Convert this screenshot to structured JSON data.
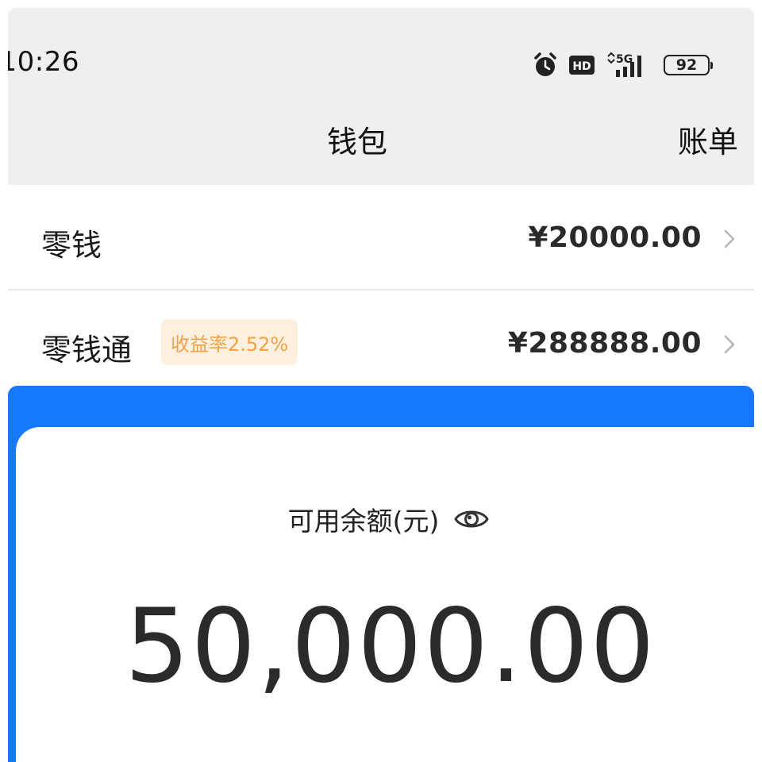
{
  "status_bar": {
    "time": "10:26",
    "battery": "92",
    "network": "5G",
    "hd": "HD",
    "icons": [
      "alarm-icon",
      "hd-icon",
      "signal-5g-icon",
      "battery-icon"
    ]
  },
  "nav": {
    "title": "钱包",
    "action": "账单"
  },
  "rows": [
    {
      "label": "零钱",
      "amount": "¥20000.00",
      "icon": "chevron-right-icon"
    },
    {
      "label": "零钱通",
      "badge": "收益率2.52%",
      "amount": "¥288888.00",
      "icon": "chevron-right-icon"
    }
  ],
  "balance": {
    "label": "可用余额(元)",
    "amount": "50,000.00",
    "icon": "eye-icon"
  },
  "colors": {
    "accent_blue": "#1677ff",
    "header_gray": "#efefef",
    "badge_bg": "#fdf0df",
    "badge_text": "#f0a24a"
  }
}
